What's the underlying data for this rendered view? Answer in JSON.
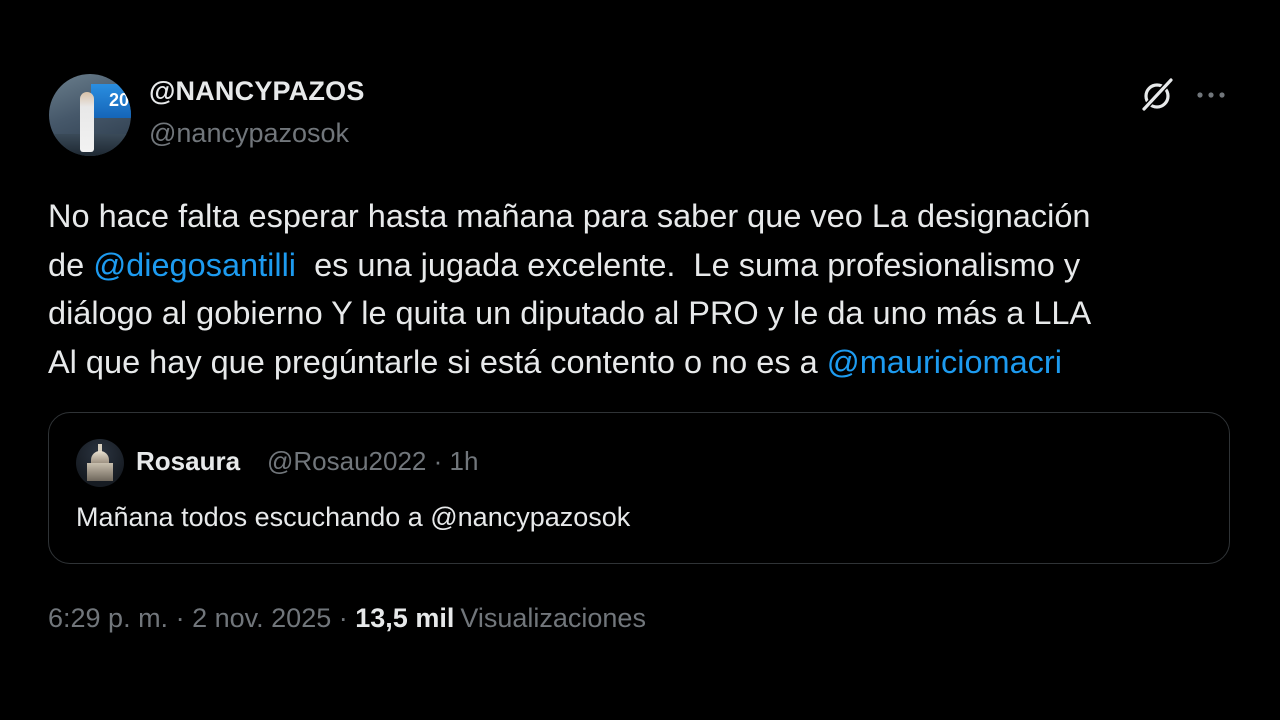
{
  "tweet": {
    "author": {
      "display_name": "@NANCYPAZOS",
      "handle": "@nancypazosok",
      "avatar_text": "20"
    },
    "icons": {
      "grok": "grok-icon",
      "more": "more-icon"
    },
    "body": {
      "line1": "No hace falta esperar hasta mañana para saber que veo La designación",
      "line2_prefix": "de ",
      "mention1": "@diegosantilli",
      "line2_suffix": "  es una jugada excelente.  Le suma profesionalismo y",
      "line3": "diálogo al gobierno Y le quita un diputado al PRO y le da uno más a LLA",
      "line4_prefix": "Al que hay que pregúntarle si está contento o no es a ",
      "mention2": "@mauriciomacri"
    },
    "quote": {
      "name": "Rosaura",
      "handle": "@Rosau2022",
      "separator": "·",
      "time": "1h",
      "text": "Mañana todos escuchando a @nancypazosok"
    },
    "footer": {
      "time": "6:29 p. m.",
      "date": "2 nov. 2025",
      "separator": "·",
      "views_count": "13,5 mil",
      "views_label": "Visualizaciones"
    },
    "colors": {
      "background": "#000000",
      "text": "#e7e9ea",
      "muted": "#71767b",
      "link": "#1d9bf0",
      "border": "#2f3336"
    }
  }
}
